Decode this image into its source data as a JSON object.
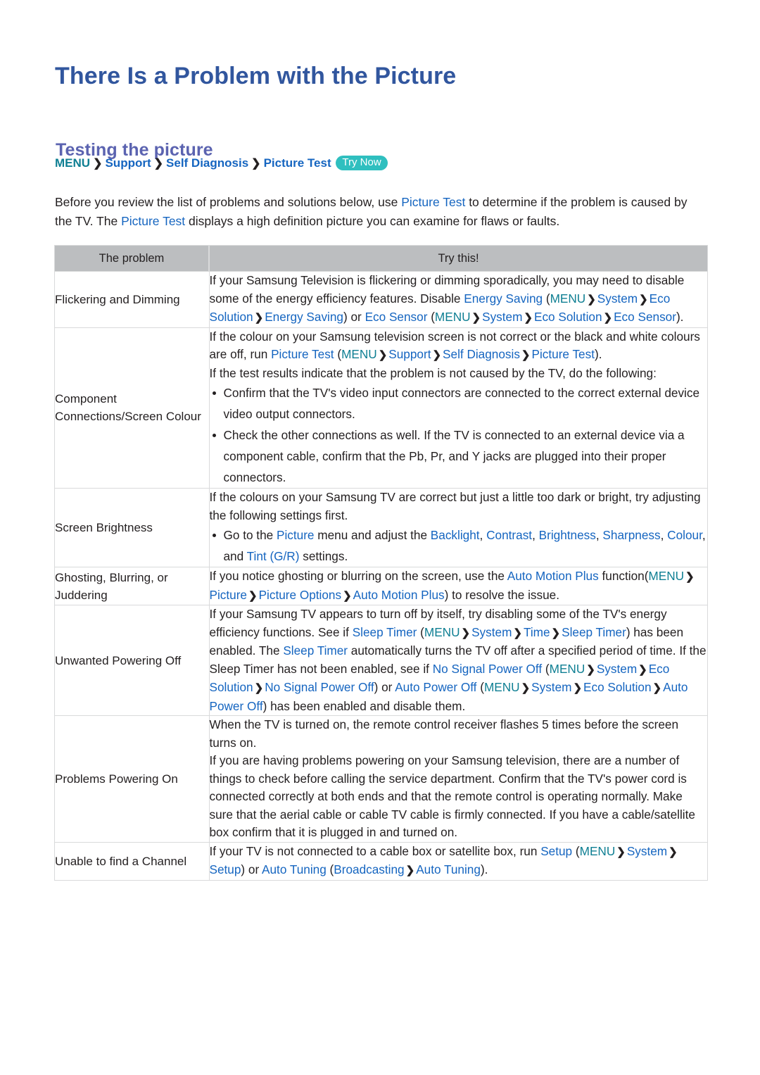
{
  "document": {
    "title": "There Is a Problem with the Picture",
    "section_title": "Testing the picture"
  },
  "breadcrumb": {
    "items": [
      "MENU",
      "Support",
      "Self Diagnosis",
      "Picture Test"
    ],
    "separator": "❯",
    "badge": "Try Now"
  },
  "intro": {
    "part1": "Before you review the list of problems and solutions below, use ",
    "link1": "Picture Test",
    "part2": " to determine if the problem is caused by the TV. The ",
    "link2": "Picture Test",
    "part3": " displays a high definition picture you can examine for flaws or faults."
  },
  "table": {
    "headers": [
      "The problem",
      "Try this!"
    ],
    "rows": [
      {
        "problem": "Flickering and Dimming",
        "answer": {
          "t1": "If your Samsung Television is flickering or dimming sporadically, you may need to disable some of the energy efficiency features. Disable ",
          "l1": "Energy Saving",
          "t2": " (",
          "m1": "MENU",
          "s1": "❯",
          "l2": "System",
          "s2": "❯",
          "l3": "Eco Solution",
          "s3": "❯",
          "l4": "Energy Saving",
          "t3": ") or ",
          "l5": "Eco Sensor",
          "t4": " (",
          "m2": "MENU",
          "s4": "❯",
          "l6": "System",
          "s5": "❯",
          "l7": "Eco Solution",
          "s6": "❯",
          "l8": "Eco Sensor",
          "t5": ")."
        }
      },
      {
        "problem": "Component Connections/Screen Colour",
        "answer": {
          "p1_t1": "If the colour on your Samsung television screen is not correct or the black and white colours are off, run ",
          "p1_l1": "Picture Test",
          "p1_t2": " (",
          "p1_m1": "MENU",
          "p1_s1": "❯",
          "p1_l2": "Support",
          "p1_s2": "❯",
          "p1_l3": "Self Diagnosis",
          "p1_s3": "❯",
          "p1_l4": "Picture Test",
          "p1_t3": ").",
          "p2": "If the test results indicate that the problem is not caused by the TV, do the following:",
          "b1": "Confirm that the TV's video input connectors are connected to the correct external device video output connectors.",
          "b2": "Check the other connections as well. If the TV is connected to an external device via a component cable, confirm that the Pb, Pr, and Y jacks are plugged into their proper connectors."
        }
      },
      {
        "problem": "Screen Brightness",
        "answer": {
          "p1": "If the colours on your Samsung TV are correct but just a little too dark or bright, try adjusting the following settings first.",
          "b1_t1": "Go to the ",
          "b1_l1": "Picture",
          "b1_t2": " menu and adjust the ",
          "b1_l2": "Backlight",
          "b1_t3": ", ",
          "b1_l3": "Contrast",
          "b1_t4": ", ",
          "b1_l4": "Brightness",
          "b1_t5": ", ",
          "b1_l5": "Sharpness",
          "b1_t6": ", ",
          "b1_l6": "Colour",
          "b1_t7": ", and ",
          "b1_l7": "Tint (G/R)",
          "b1_t8": " settings."
        }
      },
      {
        "problem": "Ghosting, Blurring, or Juddering",
        "answer": {
          "t1": "If you notice ghosting or blurring on the screen, use the ",
          "l1": "Auto Motion Plus",
          "t2": " function(",
          "m1": "MENU",
          "s1": "❯",
          "l2": "Picture",
          "s2": "❯",
          "l3": "Picture Options",
          "s3": "❯",
          "l4": "Auto Motion Plus",
          "t3": ") to resolve the issue."
        }
      },
      {
        "problem": "Unwanted Powering Off",
        "answer": {
          "t1": "If your Samsung TV appears to turn off by itself, try disabling some of the TV's energy efficiency functions. See if ",
          "l1": "Sleep Timer",
          "t2": " (",
          "m1": "MENU",
          "s1": "❯",
          "l2": "System",
          "s2": "❯",
          "l3": "Time",
          "s3": "❯",
          "l4": "Sleep Timer",
          "t3": ") has been enabled. The ",
          "l5": "Sleep Timer",
          "t4": " automatically turns the TV off after a specified period of time. If the Sleep Timer has not been enabled, see if ",
          "l6": "No Signal Power Off",
          "t5": " (",
          "m2": "MENU",
          "s4": "❯",
          "l7": "System",
          "s5": "❯",
          "l8": "Eco Solution",
          "s6": "❯",
          "l9": "No Signal Power Off",
          "t6": ") or ",
          "l10": "Auto Power Off",
          "t7": " (",
          "m3": "MENU",
          "s7": "❯",
          "l11": "System",
          "s8": "❯",
          "l12": "Eco Solution",
          "s9": "❯",
          "l13": "Auto Power Off",
          "t8": ") has been enabled and disable them."
        }
      },
      {
        "problem": "Problems Powering On",
        "answer": {
          "p1": "When the TV is turned on, the remote control receiver flashes 5 times before the screen turns on.",
          "p2": "If you are having problems powering on your Samsung television, there are a number of things to check before calling the service department. Confirm that the TV's power cord is connected correctly at both ends and that the remote control is operating normally. Make sure that the aerial cable or cable TV cable is firmly connected. If you have a cable/satellite box confirm that it is plugged in and turned on."
        }
      },
      {
        "problem": "Unable to find a Channel",
        "answer": {
          "t1": "If your TV is not connected to a cable box or satellite box, run ",
          "l1": "Setup",
          "t2": " (",
          "m1": "MENU",
          "s1": "❯",
          "l2": "System",
          "s2": "❯",
          "l3": "Setup",
          "t3": ") or ",
          "l4": "Auto Tuning",
          "t4": " (",
          "l5": "Broadcasting",
          "s3": "❯",
          "l6": "Auto Tuning",
          "t5": ")."
        }
      }
    ]
  },
  "colors": {
    "title_blue": "#31569e",
    "section_purple": "#5b63b0",
    "link_blue": "#1565c0",
    "menu_teal": "#0f7f93",
    "badge_teal": "#2fbfbf",
    "table_header_gray": "#bcbec0",
    "border_gray": "#d9dadb",
    "text_black": "#231f20"
  }
}
